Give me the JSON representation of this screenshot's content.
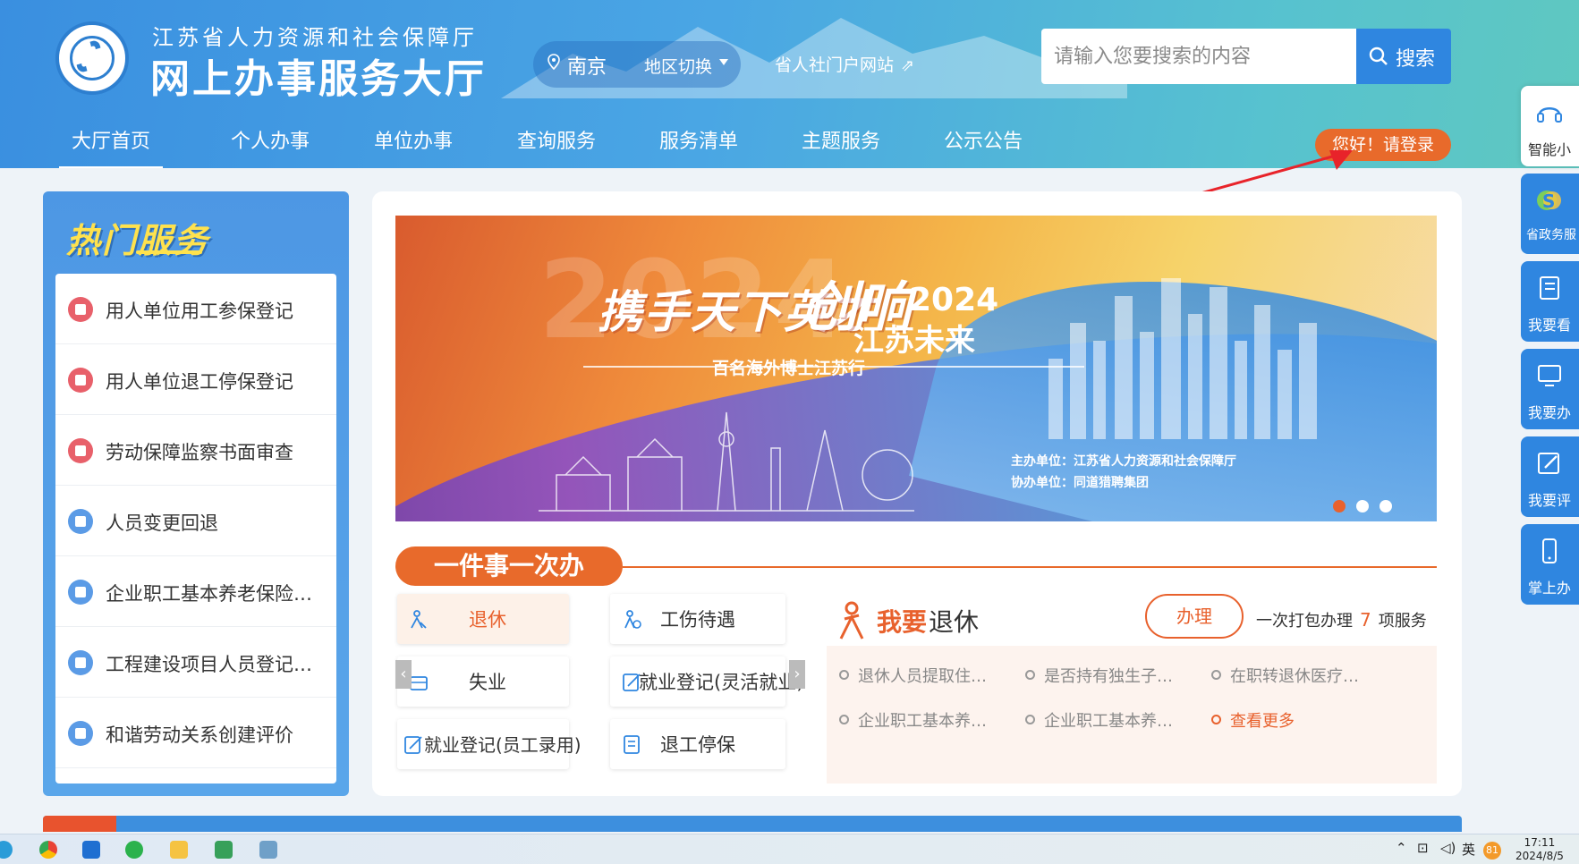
{
  "header": {
    "org_name": "江苏省人力资源和社会保障厅",
    "hall_name": "网上办事服务大厅",
    "city": "南京",
    "region_switch": "地区切换",
    "portal_link": "省人社门户网站",
    "search_placeholder": "请输入您要搜索的内容",
    "search_button": "搜索",
    "login_button": "您好！请登录"
  },
  "nav": [
    {
      "label": "大厅首页",
      "active": true
    },
    {
      "label": "个人办事"
    },
    {
      "label": "单位办事"
    },
    {
      "label": "查询服务"
    },
    {
      "label": "服务清单"
    },
    {
      "label": "主题服务"
    },
    {
      "label": "公示公告"
    }
  ],
  "float_bar": [
    {
      "label": "智能小",
      "icon": "headset-icon"
    },
    {
      "label": "省政务服",
      "icon": "js-logo-icon"
    },
    {
      "label": "我要看",
      "icon": "book-icon"
    },
    {
      "label": "我要办",
      "icon": "monitor-icon"
    },
    {
      "label": "我要评",
      "icon": "edit-icon"
    },
    {
      "label": "掌上办",
      "icon": "phone-icon"
    }
  ],
  "hot_services": {
    "title": "热门服务",
    "items": [
      {
        "label": "用人单位用工参保登记",
        "color": "#e8606a"
      },
      {
        "label": "用人单位退工停保登记",
        "color": "#e8606a"
      },
      {
        "label": "劳动保障监察书面审查",
        "color": "#e8606a"
      },
      {
        "label": "人员变更回退",
        "color": "#5b9be6"
      },
      {
        "label": "企业职工基本养老保险…",
        "color": "#5b9be6"
      },
      {
        "label": "工程建设项目人员登记…",
        "color": "#5b9be6"
      },
      {
        "label": "和谐劳动关系创建评价",
        "color": "#5b9be6"
      }
    ]
  },
  "banner": {
    "bg_year": "2024",
    "slogan_a": "携手天下英才",
    "slogan_b": "创响",
    "year": "2024",
    "slogan_c": "江苏未来",
    "subtitle": "百名海外博士江苏行",
    "host": "主办单位：江苏省人力资源和社会保障厅",
    "co_host": "协办单位：同道猎聘集团",
    "active_slide": 1,
    "slide_count": 3
  },
  "one_thing": {
    "title": "一件事一次办",
    "services": [
      {
        "label": "退休",
        "active": true,
        "icon": "retire-icon"
      },
      {
        "label": "工伤待遇",
        "icon": "injury-icon"
      },
      {
        "label": "失业",
        "icon": "unemployment-icon"
      },
      {
        "label": "就业登记(灵活就业)",
        "icon": "register-icon"
      },
      {
        "label": "就业登记(员工录用)",
        "icon": "register-icon"
      },
      {
        "label": "退工停保",
        "icon": "stop-insurance-icon"
      }
    ],
    "detail": {
      "title_highlight": "我要",
      "title_rest": "退休",
      "action": "办理",
      "pack_prefix": "一次打包办理",
      "pack_count": "7",
      "pack_suffix": "项服务",
      "links": [
        "退休人员提取住…",
        "是否持有独生子…",
        "在职转退休医疗…",
        "企业职工基本养…",
        "企业职工基本养…"
      ],
      "more": "查看更多"
    }
  },
  "taskbar": {
    "ime": "英",
    "badge": "81",
    "time": "17:11",
    "date": "2024/8/5"
  },
  "colors": {
    "primary": "#2f86e0",
    "accent": "#e86a2b"
  }
}
